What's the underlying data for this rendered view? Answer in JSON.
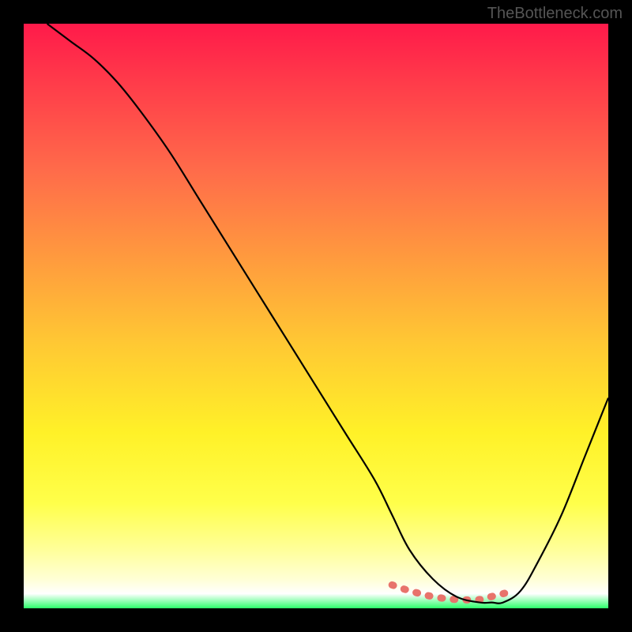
{
  "watermark": "TheBottleneck.com",
  "chart_data": {
    "type": "line",
    "title": "",
    "xlabel": "",
    "ylabel": "",
    "xlim": [
      0,
      100
    ],
    "ylim": [
      0,
      100
    ],
    "grid": false,
    "series": [
      {
        "name": "curve",
        "color": "#000000",
        "x": [
          4,
          8,
          12,
          16,
          20,
          25,
          30,
          35,
          40,
          45,
          50,
          55,
          60,
          63,
          66,
          70,
          74,
          78,
          80,
          82,
          85,
          88,
          92,
          96,
          100
        ],
        "y": [
          100,
          97,
          94,
          90,
          85,
          78,
          70,
          62,
          54,
          46,
          38,
          30,
          22,
          16,
          10,
          5,
          2,
          1,
          1,
          1,
          3,
          8,
          16,
          26,
          36
        ]
      },
      {
        "name": "highlight-band",
        "color": "#e8736b",
        "x": [
          63,
          66,
          70,
          74,
          78,
          80,
          82,
          84
        ],
        "y": [
          4,
          3,
          2,
          1.5,
          1.5,
          2,
          2.5,
          3
        ]
      }
    ],
    "background_gradient": {
      "type": "vertical",
      "stops": [
        {
          "pos": 0.0,
          "color": "#ff1a4a"
        },
        {
          "pos": 0.1,
          "color": "#ff3b4a"
        },
        {
          "pos": 0.25,
          "color": "#ff6b4a"
        },
        {
          "pos": 0.4,
          "color": "#ff9a3e"
        },
        {
          "pos": 0.55,
          "color": "#ffc933"
        },
        {
          "pos": 0.7,
          "color": "#fff128"
        },
        {
          "pos": 0.82,
          "color": "#ffff4a"
        },
        {
          "pos": 0.9,
          "color": "#ffff9a"
        },
        {
          "pos": 0.95,
          "color": "#ffffd5"
        },
        {
          "pos": 0.975,
          "color": "#ffffff"
        },
        {
          "pos": 1.0,
          "color": "#2cff6b"
        }
      ]
    }
  }
}
